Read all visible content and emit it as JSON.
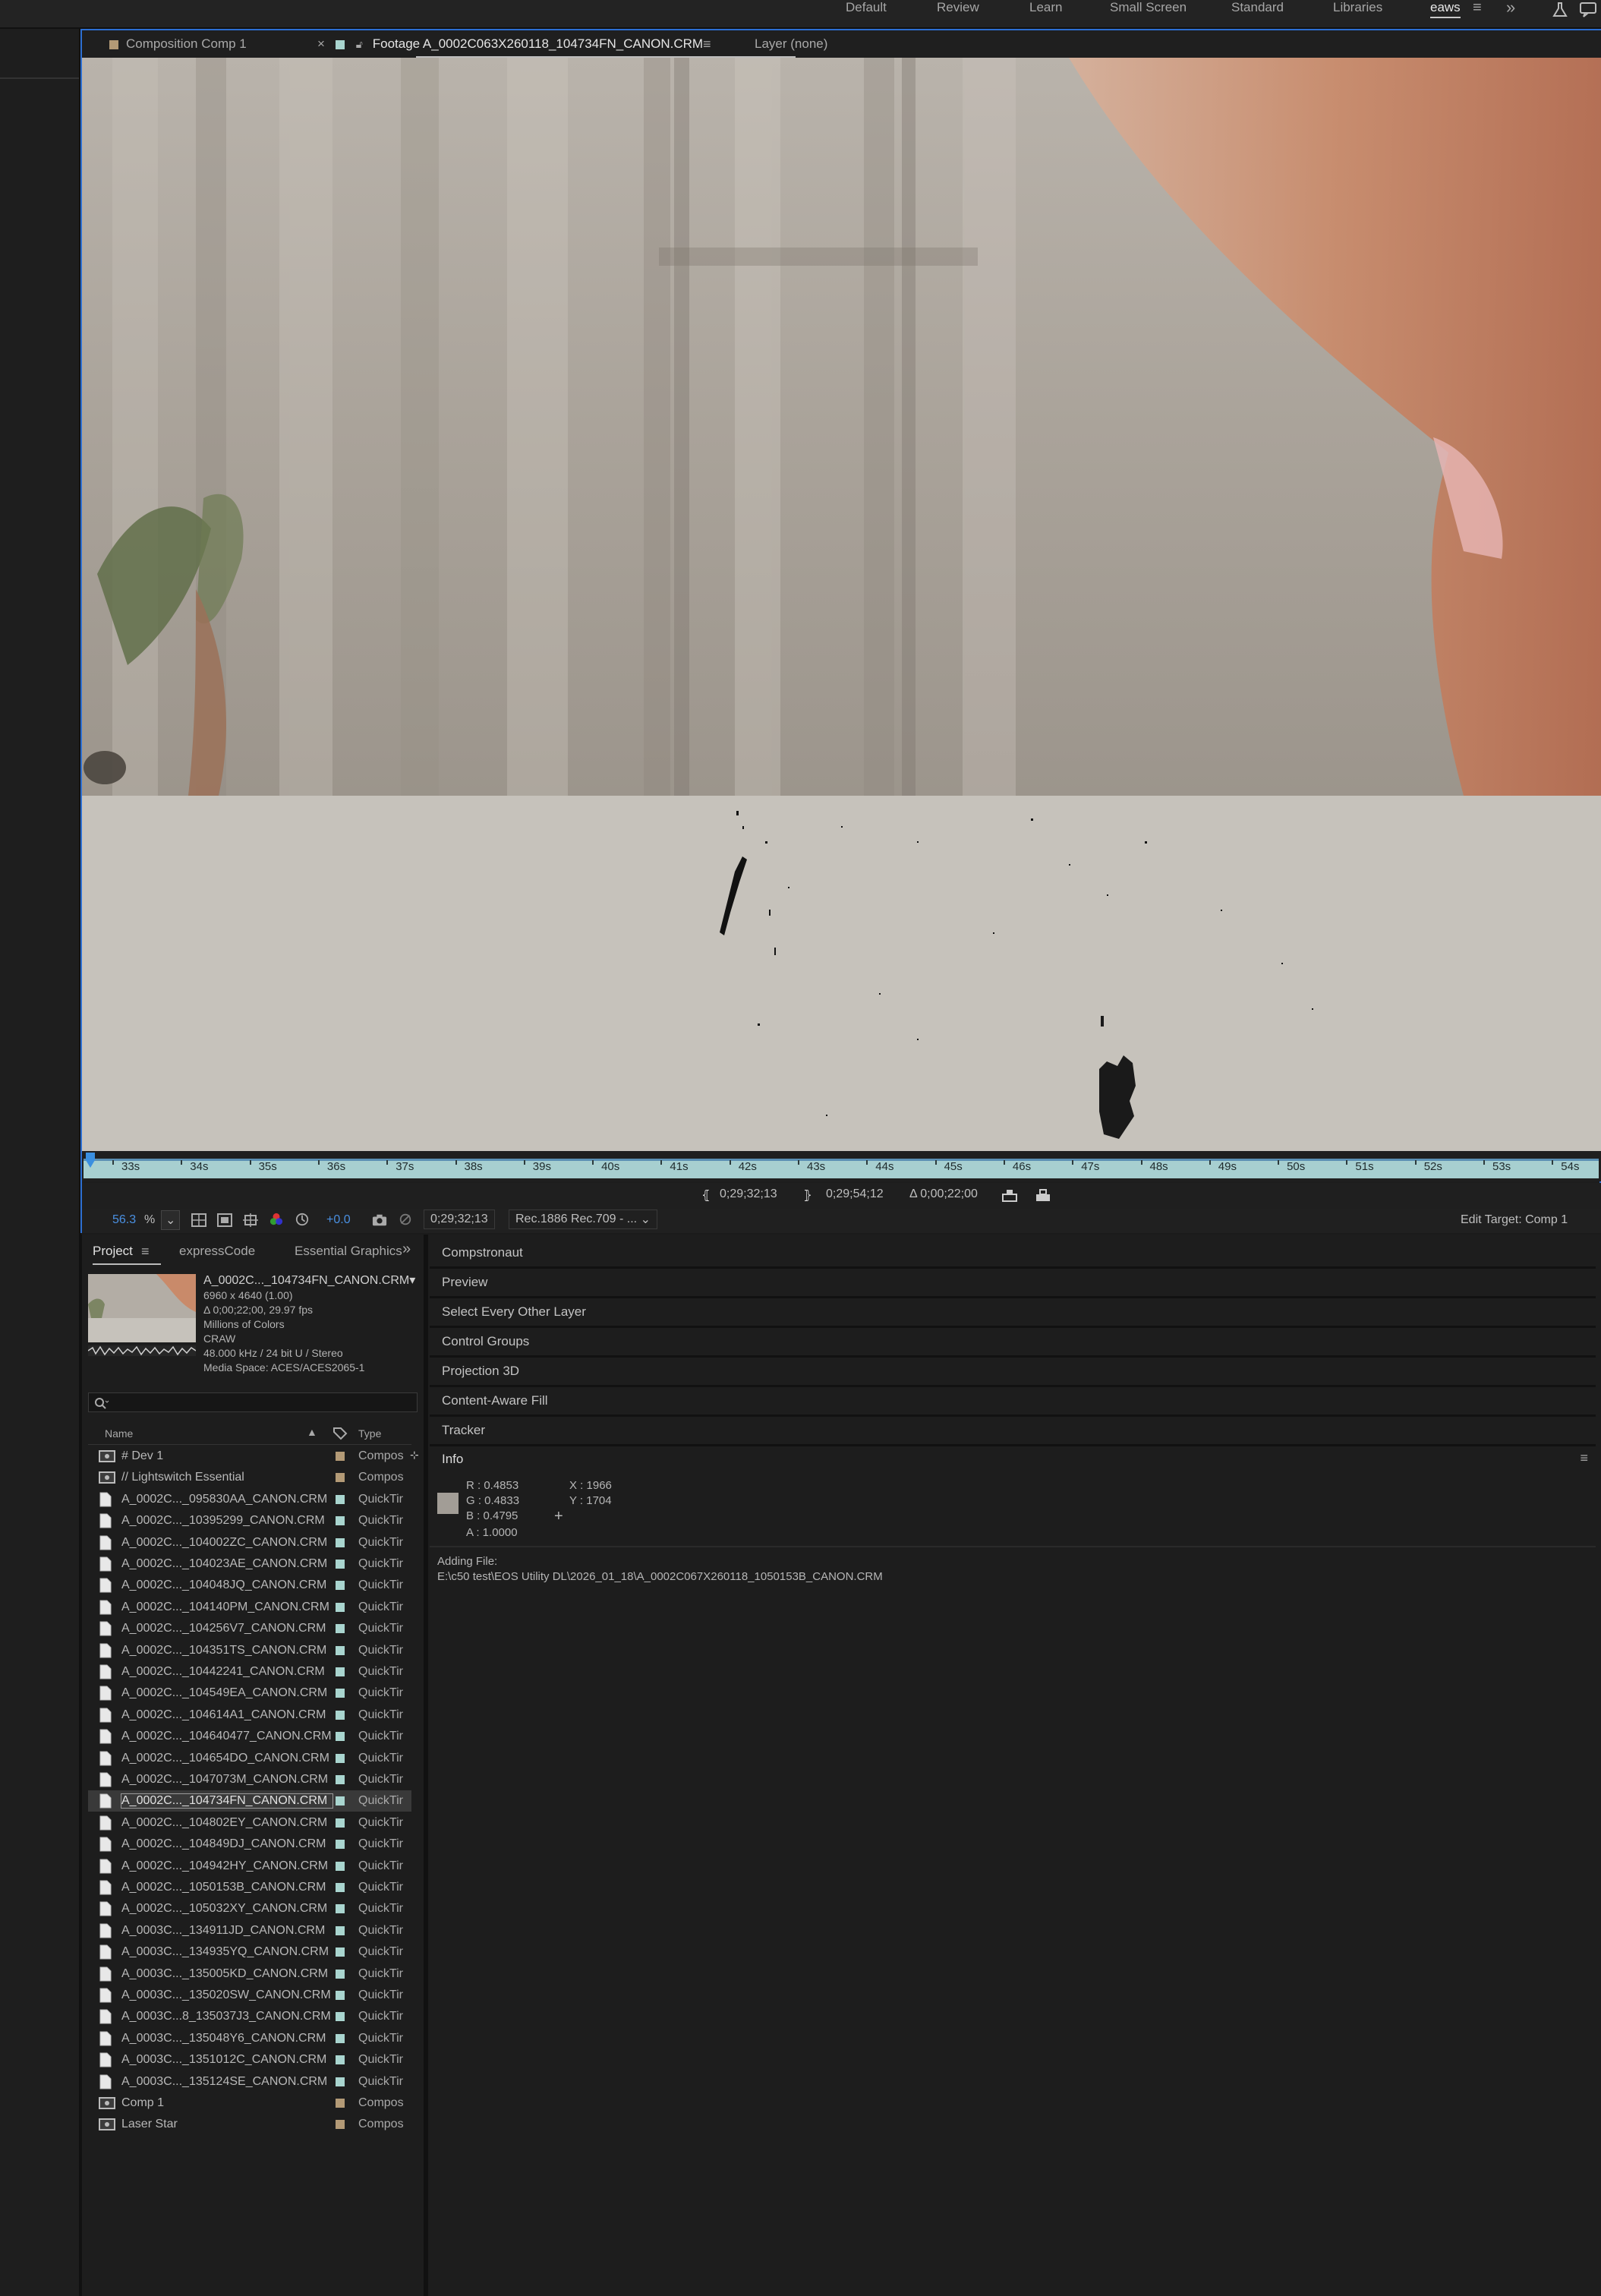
{
  "workspaces": [
    "Default",
    "Review",
    "Learn",
    "Small Screen",
    "Standard",
    "Libraries",
    "eaws"
  ],
  "workspace_more": "»",
  "viewer_tabs": {
    "comp": "Composition Comp 1",
    "footage": "Footage A_0002C063X260118_104734FN_CANON.CRM",
    "layer": "Layer (none)"
  },
  "ruler_ticks": [
    "33s",
    "34s",
    "35s",
    "36s",
    "37s",
    "38s",
    "39s",
    "40s",
    "41s",
    "42s",
    "43s",
    "44s",
    "45s",
    "46s",
    "47s",
    "48s",
    "49s",
    "50s",
    "51s",
    "52s",
    "53s",
    "54s"
  ],
  "range": {
    "in_point": "0;29;32;13",
    "out_point": "0;29;54;12",
    "duration": "Δ 0;00;22;00"
  },
  "viewer_controls": {
    "zoom": "56.3",
    "zoom_unit": "%",
    "exposure": "+0.0",
    "timecode": "0;29;32;13",
    "color_space": "Rec.1886 Rec.709 - ...",
    "edit_target": "Edit Target: Comp 1"
  },
  "project_tabs": [
    "Project",
    "expressCode",
    "Essential Graphics"
  ],
  "project_more": "»",
  "footage_info": {
    "name": "A_0002C..._104734FN_CANON.CRM▾",
    "lines": [
      "6960 x 4640 (1.00)",
      "Δ 0;00;22;00, 29.97 fps",
      "Millions of Colors",
      "CRAW",
      "48.000 kHz / 24 bit U / Stereo",
      "Media Space: ACES/ACES2065-1"
    ]
  },
  "search": {
    "placeholder": ""
  },
  "columns": {
    "name": "Name",
    "type": "Type"
  },
  "project_items": [
    {
      "name": "# Dev 1",
      "type": "Compos",
      "kind": "comp",
      "color": "#b39a76"
    },
    {
      "name": "// Lightswitch Essential",
      "type": "Compos",
      "kind": "comp",
      "color": "#b39a76"
    },
    {
      "name": "A_0002C..._095830AA_CANON.CRM",
      "type": "QuickTir",
      "kind": "file",
      "color": "#a9d5cf"
    },
    {
      "name": "A_0002C..._10395299_CANON.CRM",
      "type": "QuickTir",
      "kind": "file",
      "color": "#a9d5cf"
    },
    {
      "name": "A_0002C..._104002ZC_CANON.CRM",
      "type": "QuickTir",
      "kind": "file",
      "color": "#a9d5cf"
    },
    {
      "name": "A_0002C..._104023AE_CANON.CRM",
      "type": "QuickTir",
      "kind": "file",
      "color": "#a9d5cf"
    },
    {
      "name": "A_0002C..._104048JQ_CANON.CRM",
      "type": "QuickTir",
      "kind": "file",
      "color": "#a9d5cf"
    },
    {
      "name": "A_0002C..._104140PM_CANON.CRM",
      "type": "QuickTir",
      "kind": "file",
      "color": "#a9d5cf"
    },
    {
      "name": "A_0002C..._104256V7_CANON.CRM",
      "type": "QuickTir",
      "kind": "file",
      "color": "#a9d5cf"
    },
    {
      "name": "A_0002C..._104351TS_CANON.CRM",
      "type": "QuickTir",
      "kind": "file",
      "color": "#a9d5cf"
    },
    {
      "name": "A_0002C..._10442241_CANON.CRM",
      "type": "QuickTir",
      "kind": "file",
      "color": "#a9d5cf"
    },
    {
      "name": "A_0002C..._104549EA_CANON.CRM",
      "type": "QuickTir",
      "kind": "file",
      "color": "#a9d5cf"
    },
    {
      "name": "A_0002C..._104614A1_CANON.CRM",
      "type": "QuickTir",
      "kind": "file",
      "color": "#a9d5cf"
    },
    {
      "name": "A_0002C..._104640477_CANON.CRM",
      "type": "QuickTir",
      "kind": "file",
      "color": "#a9d5cf"
    },
    {
      "name": "A_0002C..._104654DO_CANON.CRM",
      "type": "QuickTir",
      "kind": "file",
      "color": "#a9d5cf"
    },
    {
      "name": "A_0002C..._1047073M_CANON.CRM",
      "type": "QuickTir",
      "kind": "file",
      "color": "#a9d5cf"
    },
    {
      "name": "A_0002C..._104734FN_CANON.CRM",
      "type": "QuickTir",
      "kind": "file",
      "color": "#a9d5cf",
      "selected": true
    },
    {
      "name": "A_0002C..._104802EY_CANON.CRM",
      "type": "QuickTir",
      "kind": "file",
      "color": "#a9d5cf"
    },
    {
      "name": "A_0002C..._104849DJ_CANON.CRM",
      "type": "QuickTir",
      "kind": "file",
      "color": "#a9d5cf"
    },
    {
      "name": "A_0002C..._104942HY_CANON.CRM",
      "type": "QuickTir",
      "kind": "file",
      "color": "#a9d5cf"
    },
    {
      "name": "A_0002C..._1050153B_CANON.CRM",
      "type": "QuickTir",
      "kind": "file",
      "color": "#a9d5cf"
    },
    {
      "name": "A_0002C..._105032XY_CANON.CRM",
      "type": "QuickTir",
      "kind": "file",
      "color": "#a9d5cf"
    },
    {
      "name": "A_0003C..._134911JD_CANON.CRM",
      "type": "QuickTir",
      "kind": "file",
      "color": "#a9d5cf"
    },
    {
      "name": "A_0003C..._134935YQ_CANON.CRM",
      "type": "QuickTir",
      "kind": "file",
      "color": "#a9d5cf"
    },
    {
      "name": "A_0003C..._135005KD_CANON.CRM",
      "type": "QuickTir",
      "kind": "file",
      "color": "#a9d5cf"
    },
    {
      "name": "A_0003C..._135020SW_CANON.CRM",
      "type": "QuickTir",
      "kind": "file",
      "color": "#a9d5cf"
    },
    {
      "name": "A_0003C...8_135037J3_CANON.CRM",
      "type": "QuickTir",
      "kind": "file",
      "color": "#a9d5cf"
    },
    {
      "name": "A_0003C..._135048Y6_CANON.CRM",
      "type": "QuickTir",
      "kind": "file",
      "color": "#a9d5cf"
    },
    {
      "name": "A_0003C..._1351012C_CANON.CRM",
      "type": "QuickTir",
      "kind": "file",
      "color": "#a9d5cf"
    },
    {
      "name": "A_0003C..._135124SE_CANON.CRM",
      "type": "QuickTir",
      "kind": "file",
      "color": "#a9d5cf"
    },
    {
      "name": "Comp 1",
      "type": "Compos",
      "kind": "comp",
      "color": "#b39a76"
    },
    {
      "name": "Laser Star",
      "type": "Compos",
      "kind": "comp",
      "color": "#b39a76"
    }
  ],
  "right_sections": [
    "Compstronaut",
    "Preview",
    "Select Every Other Layer",
    "Control Groups",
    "Projection 3D",
    "Content-Aware Fill",
    "Tracker"
  ],
  "info_panel": {
    "title": "Info",
    "r": "R :  0.4853",
    "g": "G :  0.4833",
    "b": "B :  0.4795",
    "a": "A :  1.0000",
    "x": "X :  1966",
    "y": "Y :  1704",
    "swatch_color": "#a29d96"
  },
  "status": {
    "label": "Adding File:",
    "path": "E:\\c50 test\\EOS Utility DL\\2026_01_18\\A_0002C067X260118_1050153B_CANON.CRM"
  },
  "colors": {
    "accent": "#2d6fd2",
    "zoom_blue": "#4a90e2",
    "ruler": "#a7cfd0"
  }
}
